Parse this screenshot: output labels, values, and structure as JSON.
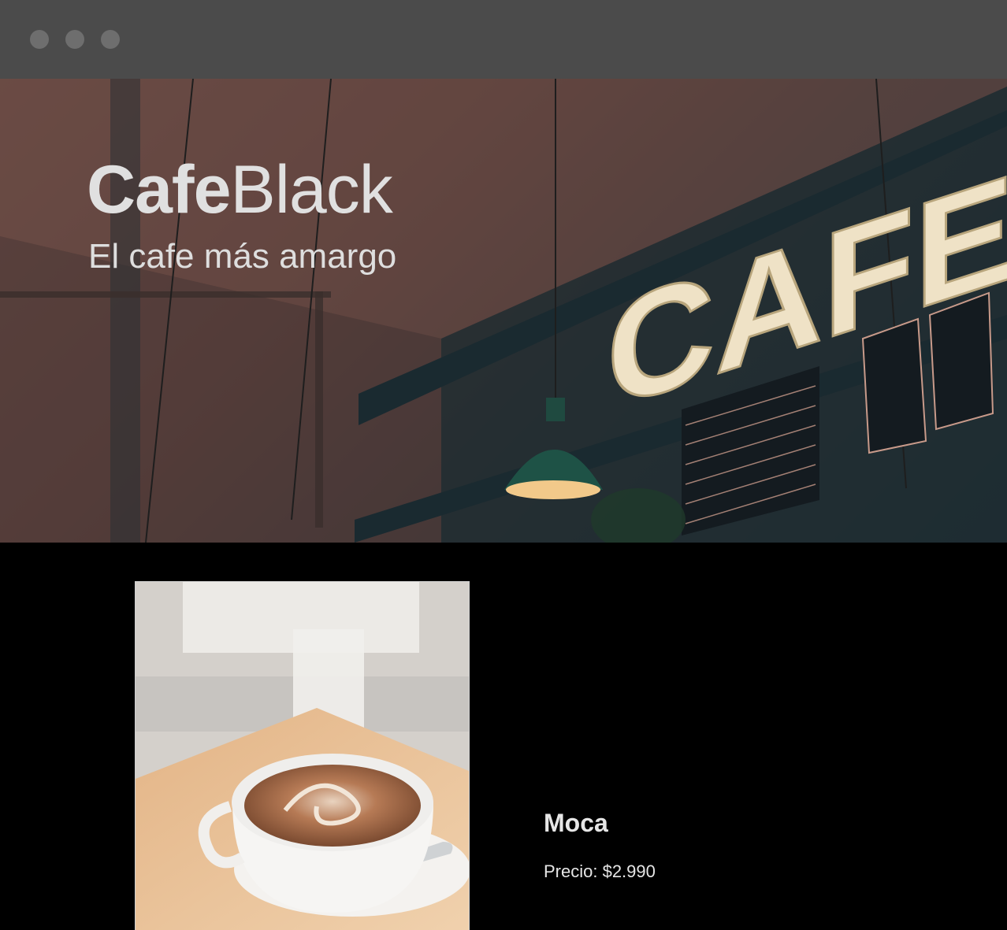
{
  "window": {
    "controls": [
      "close-dot",
      "minimize-dot",
      "maximize-dot"
    ]
  },
  "hero": {
    "brand_bold": "Cafe",
    "brand_light": "Black",
    "tagline": "El cafe más amargo",
    "sign_text": "CAFE"
  },
  "product": {
    "name": "Moca",
    "price_label": "Precio: $2.990"
  },
  "colors": {
    "background": "#000000",
    "window_bar": "#4b4b4b",
    "text": "#e0e0e0"
  }
}
